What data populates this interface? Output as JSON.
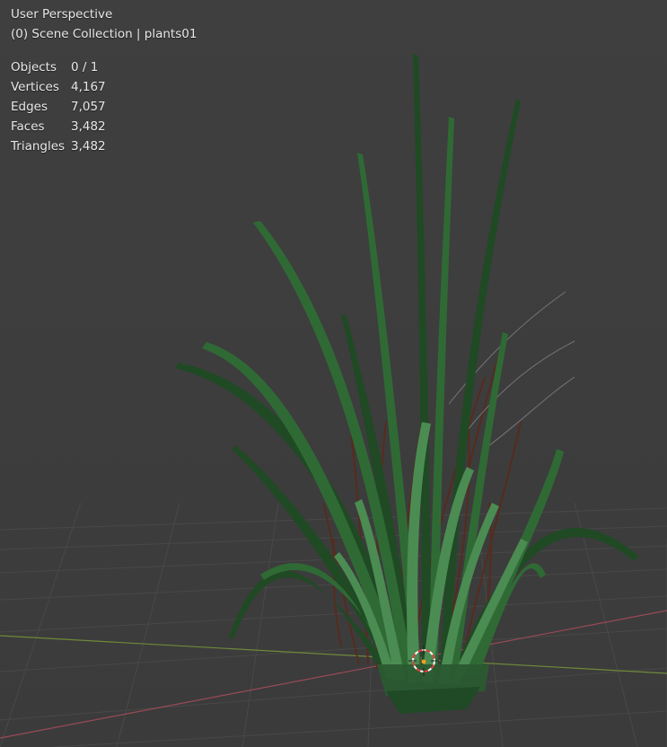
{
  "viewport": {
    "view_name": "User Perspective",
    "collection_line": "(0) Scene Collection | plants01"
  },
  "stats": [
    {
      "label": "Objects",
      "value": "0 / 1"
    },
    {
      "label": "Vertices",
      "value": "4,167"
    },
    {
      "label": "Edges",
      "value": "7,057"
    },
    {
      "label": "Faces",
      "value": "3,482"
    },
    {
      "label": "Triangles",
      "value": "3,482"
    }
  ],
  "colors": {
    "background": "#3d3d3d",
    "grid": "#4a4a4a",
    "x_axis": "#9a4a55",
    "y_axis": "#6e8a3a",
    "leaf_dark": "#1f4a24",
    "leaf_mid": "#2f6a35",
    "leaf_light": "#4b8c52",
    "dry_stem": "#5a2a1a"
  }
}
